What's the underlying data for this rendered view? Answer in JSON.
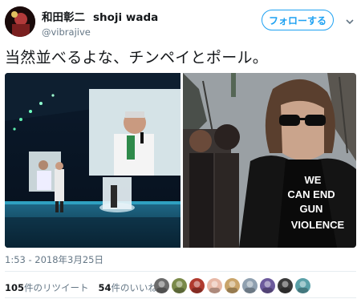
{
  "user": {
    "display_name": "和田彰二",
    "english_name": "shoji wada",
    "handle": "@vibrajive"
  },
  "follow_button": {
    "label": "フォローする"
  },
  "tweet": {
    "text": "当然並べるよな、チンペイとポール。",
    "timestamp": "1:53 - 2018年3月25日"
  },
  "photo_right": {
    "shirt_text": [
      "WE",
      "CAN END",
      "GUN",
      "VIOLENCE"
    ]
  },
  "stats": {
    "retweets_count": "105",
    "retweets_label": "件のリツイート",
    "likes_count": "54",
    "likes_label": "件のいいね"
  },
  "colors": {
    "accent": "#1da1f2",
    "muted": "#657786",
    "text": "#14171a"
  },
  "likers": [
    {
      "icon": "liker-avatar-1",
      "color": "#6b6b6b"
    },
    {
      "icon": "liker-avatar-2",
      "color": "#7a8a4a"
    },
    {
      "icon": "liker-avatar-3",
      "color": "#b03a2e"
    },
    {
      "icon": "liker-avatar-4",
      "color": "#e7b8a6"
    },
    {
      "icon": "liker-avatar-5",
      "color": "#c9a46a"
    },
    {
      "icon": "liker-avatar-6",
      "color": "#8fa0b0"
    },
    {
      "icon": "liker-avatar-7",
      "color": "#6c5a9c"
    },
    {
      "icon": "liker-avatar-8",
      "color": "#3a3a3a"
    },
    {
      "icon": "liker-avatar-9",
      "color": "#5aa0a8"
    }
  ]
}
